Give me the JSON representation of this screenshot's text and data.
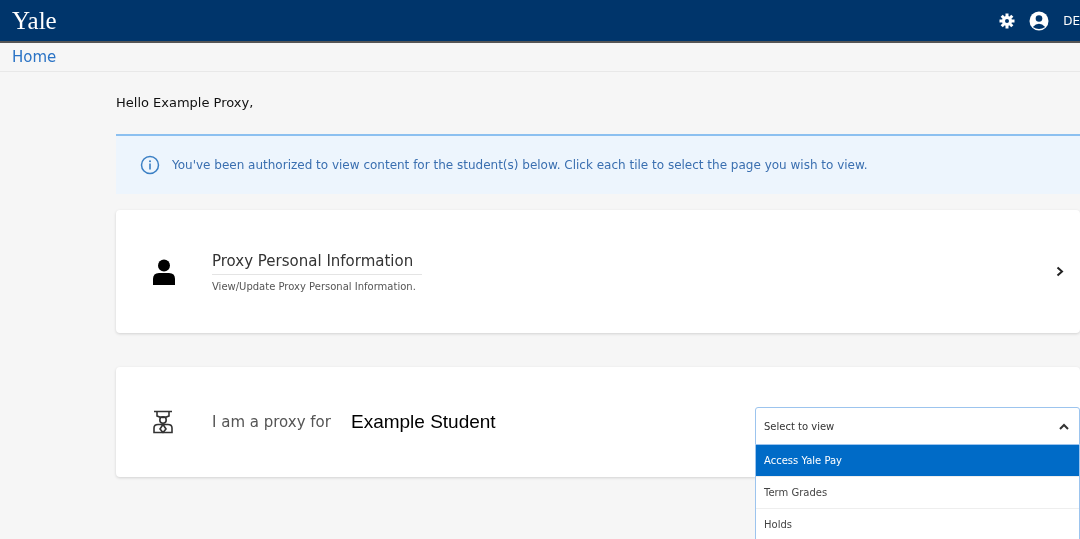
{
  "header": {
    "logo": "Yale",
    "user_label": "DE"
  },
  "breadcrumb": {
    "label": "Home"
  },
  "greeting": "Hello Example Proxy,",
  "info_banner": {
    "text": "You've been authorized to view content for the student(s) below. Click each tile to select the page you wish to view."
  },
  "personal_tile": {
    "title": "Proxy Personal Information",
    "subtitle": "View/Update Proxy Personal Information."
  },
  "proxy_tile": {
    "label": "I am a proxy for",
    "student": "Example Student",
    "dropdown": {
      "placeholder": "Select to view",
      "expanded": true,
      "options": [
        {
          "label": "Access Yale Pay",
          "selected": true
        },
        {
          "label": "Term Grades",
          "selected": false
        },
        {
          "label": "Holds",
          "selected": false
        }
      ]
    }
  }
}
